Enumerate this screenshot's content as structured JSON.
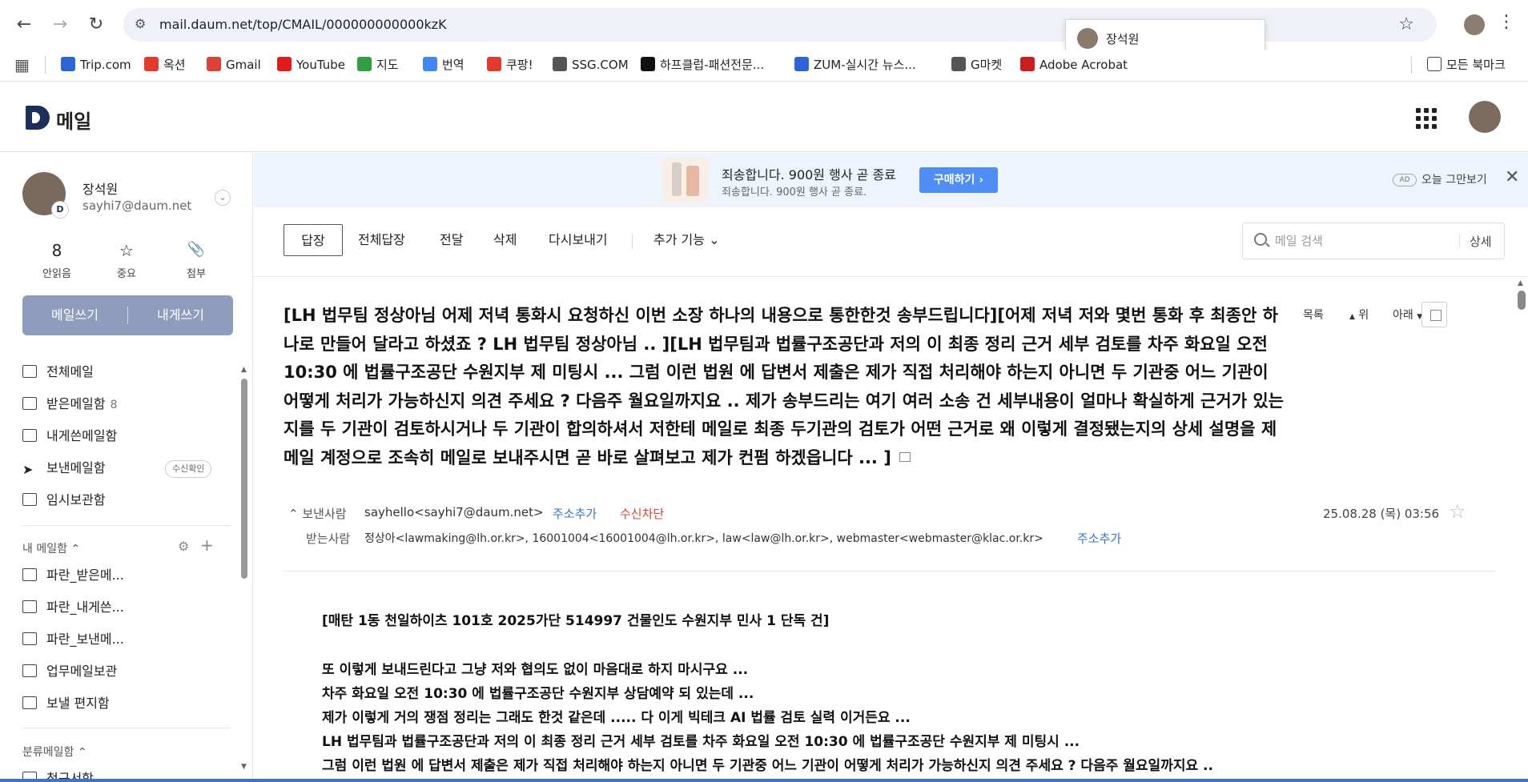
{
  "browser": {
    "url": "mail.daum.net/top/CMAIL/000000000000kzK",
    "profile_popup_name": "장석원",
    "bookmarks": [
      {
        "label": "Trip.com",
        "color": "#2d65d9"
      },
      {
        "label": "옥션",
        "color": "#e23b2e"
      },
      {
        "label": "Gmail",
        "color": "#d9433a"
      },
      {
        "label": "YouTube",
        "color": "#e11b1b"
      },
      {
        "label": "지도",
        "color": "#2f9e44"
      },
      {
        "label": "번역",
        "color": "#4285f4"
      },
      {
        "label": "쿠팡!",
        "color": "#e23b2e"
      },
      {
        "label": "SSG.COM",
        "color": "#555555"
      },
      {
        "label": "하프클럽-패션전문...",
        "color": "#111111"
      },
      {
        "label": "ZUM-실시간 뉴스...",
        "color": "#2d65d9"
      },
      {
        "label": "G마켓",
        "color": "#555555"
      },
      {
        "label": "Adobe Acrobat",
        "color": "#c8201e"
      }
    ],
    "all_bookmarks": "모든 북마크"
  },
  "app": {
    "title": "메일"
  },
  "user": {
    "name": "장석원",
    "email": "sayhi7@daum.net",
    "badge": "D"
  },
  "stats": [
    {
      "value": "8",
      "label": "안읽음"
    },
    {
      "value": "",
      "label": "중요"
    },
    {
      "value": "",
      "label": "첨부"
    }
  ],
  "compose": {
    "write": "메일쓰기",
    "self": "내게쓰기"
  },
  "folders": [
    {
      "label": "전체메일",
      "count": ""
    },
    {
      "label": "받은메일함",
      "count": "8"
    },
    {
      "label": "내게쓴메일함",
      "count": ""
    },
    {
      "label": "보낸메일함",
      "count": ""
    },
    {
      "label": "임시보관함",
      "count": ""
    }
  ],
  "read_check": "수신확인",
  "my_folders_title": "내 메일함",
  "my_folders": [
    "파란_받은메...",
    "파란_내게쓴...",
    "파란_보낸메...",
    "업무메일보관",
    "보낼 편지함"
  ],
  "category_title": "분류메일함",
  "category_partial": "청구서함",
  "ad": {
    "title": "죄송합니다. 900원 행사 곧 종료",
    "subtitle": "죄송합니다. 900원 행사 곧 종료.",
    "button": "구매하기",
    "tag": "AD",
    "dismiss": "오늘 그만보기"
  },
  "toolbar": {
    "reply": "답장",
    "reply_all": "전체답장",
    "forward": "전달",
    "delete": "삭제",
    "resend": "다시보내기",
    "more": "추가 기능",
    "search_placeholder": "메일 검색",
    "search_detail": "상세"
  },
  "message": {
    "subject": "[LH 법무팀 정상아님 어제 저녁 통화시 요청하신 이번 소장 하나의 내용으로 통한한것 송부드립니다][어제 저녁 저와 몇번 통화 후 최종안 하나로 만들어 달라고 하셨죠 ? LH 법무팀 정상아님 .. ][LH 법무팀과 법률구조공단과 저의 이 최종 정리 근거 세부 검토를 차주 화요일 오전 10:30 에 법률구조공단 수원지부 제 미팅시 ... 그럼 이런 법원 에 답변서 제출은 제가 직접 처리해야 하는지 아니면 두 기관중 어느 기관이 어떻게 처리가 가능하신지 의견 주세요 ? 다음주 월요일까지요 .. 제가 송부드리는 여기 여러 소송 건 세부내용이 얼마나 확실하게 근거가 있는지를 두 기관이 검토하시거나 두 기관이 합의하셔서 저한테 메일로 최종 두기관의 검토가 어떤 근거로 왜 이렇게 결정됐는지의 상세 설명을 제 메일 계정으로 조속히 메일로 보내주시면 곧 바로 살펴보고 제가 컨펌 하겠읍니다 ... ]",
    "nav_list": "목록",
    "nav_up": "위",
    "nav_down": "아래",
    "from_label": "보낸사람",
    "from": "sayhello<sayhi7@daum.net>",
    "add_contact": "주소추가",
    "block": "수신차단",
    "to_label": "받는사람",
    "to": "정상아<lawmaking@lh.or.kr>, 16001004<16001004@lh.or.kr>, law<law@lh.or.kr>, webmaster<webmaster@klac.or.kr>",
    "add_contact2": "주소추가",
    "date": "25.08.28 (목) 03:56",
    "body": [
      "[매탄 1동 천일하이츠 101호 2025가단 514997 건물인도 수원지부 민사 1 단독 건]",
      "",
      "또 이렇게 보내드린다고 그냥 저와 협의도 없이 마음대로 하지 마시구요 ...",
      "차주 화요일 오전 10:30 에 법률구조공단  수원지부 상담예약 되 있는데 ...",
      "제가 이렇게 거의 쟁점 정리는 그래도 한것 같은데  ..... 다 이게 빅테크 AI 법률 검토 실력 이거든요 ...",
      "LH 법무팀과 법률구조공단과 저의 이 최종 정리 근거 세부 검토를 차주 화요일 오전 10:30 에 법률구조공단 수원지부 제 미팅시 ...",
      "그럼 이런 법원 에 답변서 제출은 제가 직접 처리해야 하는지 아니면 두 기관중 어느 기관이 어떻게 처리가 가능하신지 의견 주세요 ?  다음주 월요일까지요 .."
    ]
  }
}
